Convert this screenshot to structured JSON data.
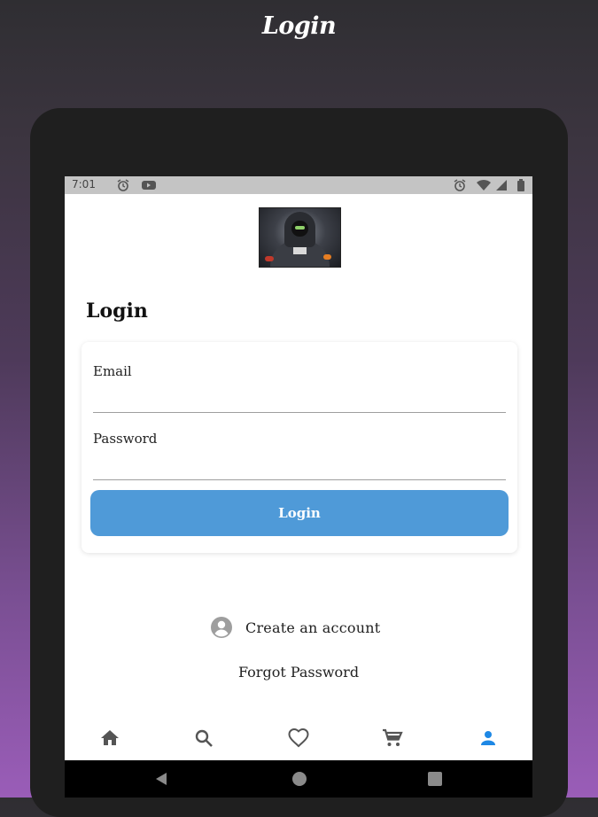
{
  "promo": {
    "title": "Login"
  },
  "status_bar": {
    "time": "7:01",
    "left_icons": [
      "alarm-icon",
      "youtube-icon"
    ],
    "right_icons": [
      "alarm-icon",
      "wifi-icon",
      "signal-icon",
      "battery-icon"
    ]
  },
  "header": {
    "image": "hooded-figure-image",
    "heading": "Login"
  },
  "form": {
    "email_label": "Email",
    "email_value": "",
    "password_label": "Password",
    "password_value": "",
    "submit_label": "Login"
  },
  "links": {
    "create_account": "Create an account",
    "forgot_password": "Forgot Password"
  },
  "bottom_nav": {
    "items": [
      {
        "icon": "home-icon",
        "active": false
      },
      {
        "icon": "search-icon",
        "active": false
      },
      {
        "icon": "heart-icon",
        "active": false
      },
      {
        "icon": "cart-icon",
        "active": false
      },
      {
        "icon": "person-icon",
        "active": true
      }
    ]
  },
  "system_nav": [
    "back-icon",
    "home-circle-icon",
    "recents-icon"
  ],
  "colors": {
    "accent": "#4f9ad8",
    "active_nav": "#1e88e5",
    "inactive_nav": "#555555",
    "status_bar": "#c4c4c4"
  }
}
